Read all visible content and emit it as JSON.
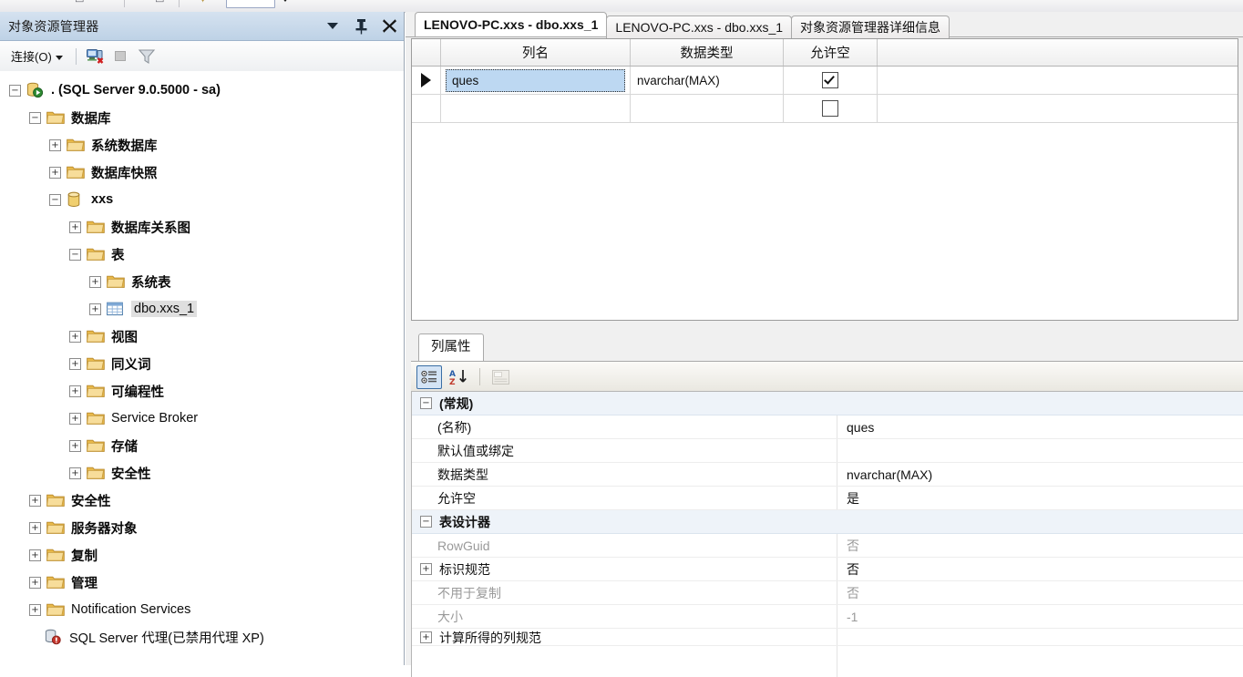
{
  "toolstrip": {
    "present": true
  },
  "object_explorer": {
    "title": "对象资源管理器",
    "buttons": {
      "dropdown": "chevron-down-icon",
      "pin": "pin-icon",
      "close": "close-icon"
    },
    "toolbar": {
      "connect_label": "连接(O)",
      "disconnect_icon": "disconnect-icon",
      "stop_icon": "stop-icon",
      "filter_icon": "filter-icon"
    },
    "tree": [
      {
        "label": ". (SQL Server 9.0.5000 - sa)",
        "depth": 0,
        "expander": "minus",
        "icon": "server-icon",
        "bold": true,
        "selected": false
      },
      {
        "label": "数据库",
        "depth": 1,
        "expander": "minus",
        "icon": "folder-icon",
        "bold": true,
        "selected": false
      },
      {
        "label": "系统数据库",
        "depth": 2,
        "expander": "plus",
        "icon": "folder-icon",
        "bold": true,
        "selected": false
      },
      {
        "label": "数据库快照",
        "depth": 2,
        "expander": "plus",
        "icon": "folder-icon",
        "bold": true,
        "selected": false
      },
      {
        "label": "xxs",
        "depth": 2,
        "expander": "minus",
        "icon": "database-icon",
        "bold": true,
        "selected": false
      },
      {
        "label": "数据库关系图",
        "depth": 3,
        "expander": "plus",
        "icon": "folder-icon",
        "bold": true,
        "selected": false
      },
      {
        "label": "表",
        "depth": 3,
        "expander": "minus",
        "icon": "folder-icon",
        "bold": true,
        "selected": false
      },
      {
        "label": "系统表",
        "depth": 4,
        "expander": "plus",
        "icon": "folder-icon",
        "bold": true,
        "selected": false
      },
      {
        "label": "dbo.xxs_1",
        "depth": 4,
        "expander": "plus",
        "icon": "table-icon",
        "bold": false,
        "selected": true
      },
      {
        "label": "视图",
        "depth": 3,
        "expander": "plus",
        "icon": "folder-icon",
        "bold": true,
        "selected": false
      },
      {
        "label": "同义词",
        "depth": 3,
        "expander": "plus",
        "icon": "folder-icon",
        "bold": true,
        "selected": false
      },
      {
        "label": "可编程性",
        "depth": 3,
        "expander": "plus",
        "icon": "folder-icon",
        "bold": true,
        "selected": false
      },
      {
        "label": "Service Broker",
        "depth": 3,
        "expander": "plus",
        "icon": "folder-icon",
        "bold": false,
        "selected": false
      },
      {
        "label": "存储",
        "depth": 3,
        "expander": "plus",
        "icon": "folder-icon",
        "bold": true,
        "selected": false
      },
      {
        "label": "安全性",
        "depth": 3,
        "expander": "plus",
        "icon": "folder-icon",
        "bold": true,
        "selected": false
      },
      {
        "label": "安全性",
        "depth": 1,
        "expander": "plus",
        "icon": "folder-icon",
        "bold": true,
        "selected": false
      },
      {
        "label": "服务器对象",
        "depth": 1,
        "expander": "plus",
        "icon": "folder-icon",
        "bold": true,
        "selected": false
      },
      {
        "label": "复制",
        "depth": 1,
        "expander": "plus",
        "icon": "folder-icon",
        "bold": true,
        "selected": false
      },
      {
        "label": "管理",
        "depth": 1,
        "expander": "plus",
        "icon": "folder-icon",
        "bold": true,
        "selected": false
      },
      {
        "label": "Notification Services",
        "depth": 1,
        "expander": "plus",
        "icon": "folder-icon",
        "bold": false,
        "selected": false
      },
      {
        "label": "SQL Server 代理(已禁用代理 XP)",
        "depth": 1,
        "expander": "none",
        "icon": "agent-icon",
        "bold": false,
        "selected": false
      }
    ]
  },
  "document_tabs": [
    {
      "label": "LENOVO-PC.xxs - dbo.xxs_1",
      "active": true
    },
    {
      "label": "LENOVO-PC.xxs - dbo.xxs_1",
      "active": false
    },
    {
      "label": "对象资源管理器详细信息",
      "active": false
    }
  ],
  "table_designer": {
    "columns": [
      "列名",
      "数据类型",
      "允许空"
    ],
    "rows": [
      {
        "indicator": true,
        "name": "ques",
        "name_selected": true,
        "datatype": "nvarchar(MAX)",
        "allow_nulls": true
      },
      {
        "indicator": false,
        "name": "",
        "name_selected": false,
        "datatype": "",
        "allow_nulls": false
      }
    ]
  },
  "column_properties": {
    "tab_label": "列属性",
    "toolbar": {
      "categorized_icon": "categorized-view-icon",
      "alphabetical_icon": "sort-alphabetical-icon",
      "property_pages_icon": "property-pages-icon"
    },
    "rows": [
      {
        "expander": "minus",
        "name": "(常规)",
        "value": "",
        "category": true,
        "dim_name": false,
        "dim_value": false,
        "clipped": false
      },
      {
        "expander": "none",
        "name": "(名称)",
        "value": "ques",
        "category": false,
        "dim_name": false,
        "dim_value": false,
        "clipped": false
      },
      {
        "expander": "none",
        "name": "默认值或绑定",
        "value": "",
        "category": false,
        "dim_name": false,
        "dim_value": false,
        "clipped": false
      },
      {
        "expander": "none",
        "name": "数据类型",
        "value": "nvarchar(MAX)",
        "category": false,
        "dim_name": false,
        "dim_value": false,
        "clipped": false
      },
      {
        "expander": "none",
        "name": "允许空",
        "value": "是",
        "category": false,
        "dim_name": false,
        "dim_value": false,
        "clipped": false
      },
      {
        "expander": "minus",
        "name": "表设计器",
        "value": "",
        "category": true,
        "dim_name": false,
        "dim_value": false,
        "clipped": false
      },
      {
        "expander": "none",
        "name": "RowGuid",
        "value": "否",
        "category": false,
        "dim_name": true,
        "dim_value": true,
        "clipped": false
      },
      {
        "expander": "plus",
        "name": "标识规范",
        "value": "否",
        "category": false,
        "dim_name": false,
        "dim_value": false,
        "clipped": false
      },
      {
        "expander": "none",
        "name": "不用于复制",
        "value": "否",
        "category": false,
        "dim_name": true,
        "dim_value": true,
        "clipped": false
      },
      {
        "expander": "none",
        "name": "大小",
        "value": "-1",
        "category": false,
        "dim_name": true,
        "dim_value": true,
        "clipped": false
      },
      {
        "expander": "plus",
        "name": "计算所得的列规范",
        "value": "",
        "category": false,
        "dim_name": false,
        "dim_value": false,
        "clipped": true
      }
    ]
  },
  "colors": {
    "panel_title_top": "#d5e2f0",
    "panel_title_bottom": "#bed2e6",
    "selection_blue": "#bdd8f2",
    "category_row": "#eef3f9",
    "folder_yellow": "#f0c75e"
  }
}
